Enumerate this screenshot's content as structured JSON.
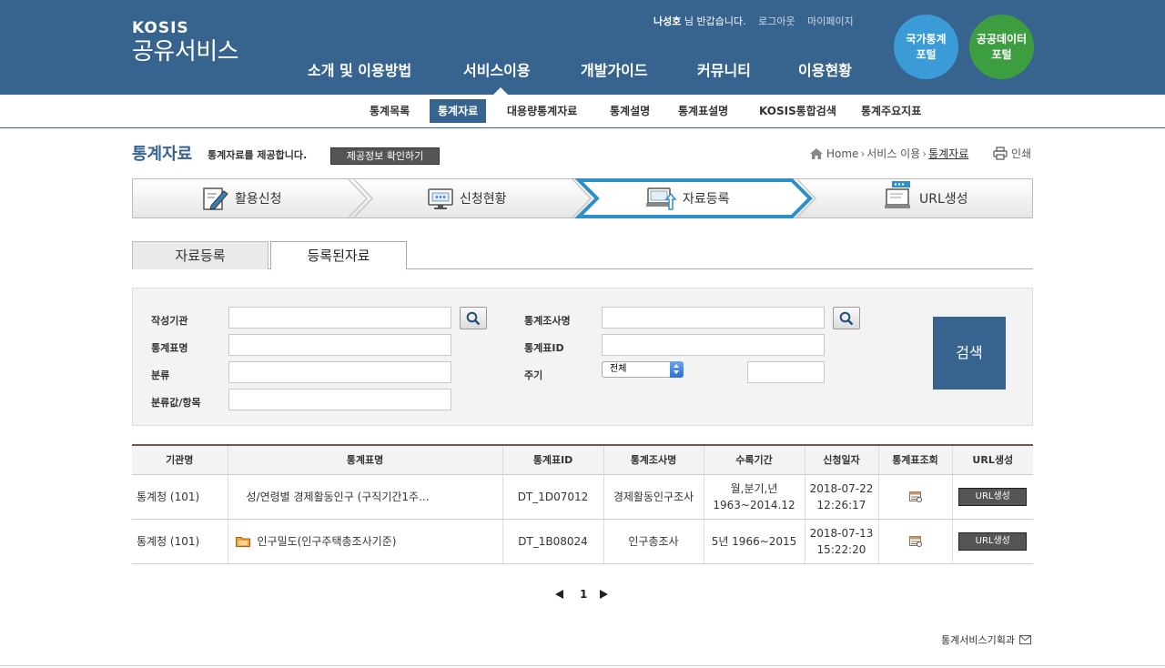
{
  "header": {
    "logo_top": "KOSIS",
    "logo_bottom": "공유서비스",
    "user_name": "나성호",
    "greeting": "님 반갑습니다.",
    "logout": "로그아웃",
    "mypage": "마이페이지",
    "gnb": [
      "소개 및 이용방법",
      "서비스이용",
      "개발가이드",
      "커뮤니티",
      "이용현황"
    ],
    "portal1": "국가통계 포털",
    "portal2": "공공데이터 포털",
    "colors": {
      "header_bg": "#37648f",
      "portal1": "#3a9bd7",
      "portal2": "#3d9e41"
    }
  },
  "subnav": {
    "items": [
      "통계목록",
      "통계자료",
      "대용량통계자료",
      "통계설명",
      "통계표설명",
      "KOSIS통합검색",
      "통계주요지표"
    ],
    "active": "통계자료"
  },
  "page": {
    "title": "통계자료",
    "description": "통계자료를 제공합니다.",
    "confirm_button": "제공정보 확인하기",
    "breadcrumb": [
      "Home",
      "서비스 이용",
      "통계자료"
    ],
    "print": "인쇄"
  },
  "steps": [
    {
      "label": "활용신청",
      "icon": "edit-form-icon"
    },
    {
      "label": "신청현황",
      "icon": "monitor-icon"
    },
    {
      "label": "자료등록",
      "icon": "upload-monitor-icon",
      "active": true
    },
    {
      "label": "URL생성",
      "icon": "url-monitor-icon"
    }
  ],
  "tabs": [
    "자료등록",
    "등록된자료"
  ],
  "search": {
    "org_label": "작성기관",
    "survey_label": "통계조사명",
    "table_name_label": "통계표명",
    "table_id_label": "통계표ID",
    "category_label": "분류",
    "cycle_label": "주기",
    "cycle_selected": "전체",
    "item_label": "분류값/항목",
    "search_button": "검색"
  },
  "table": {
    "headers": [
      "기관명",
      "통계표명",
      "통계표ID",
      "통계조사명",
      "수록기간",
      "신청일자",
      "통계표조회",
      "URL생성"
    ],
    "rows": [
      {
        "org": "통계청 (101)",
        "name": "성/연령별 경제활동인구 (구직기간1주...",
        "id": "DT_1D07012",
        "survey": "경제활동인구조사",
        "period1": "월,분기,년",
        "period2": "1963~2014.12",
        "date": "2018-07-22",
        "time": "12:26:17",
        "url_button": "URL생성"
      },
      {
        "org": "통계청 (101)",
        "name": "인구밀도(인구주택총조사기준)",
        "id": "DT_1B08024",
        "survey": "인구총조사",
        "period1": "5년 1966~2015",
        "period2": "",
        "date": "2018-07-13",
        "time": "15:22:20",
        "url_button": "URL생성"
      }
    ]
  },
  "pagination": {
    "current": "1"
  },
  "footer": {
    "contact": "통계서비스기획과"
  }
}
